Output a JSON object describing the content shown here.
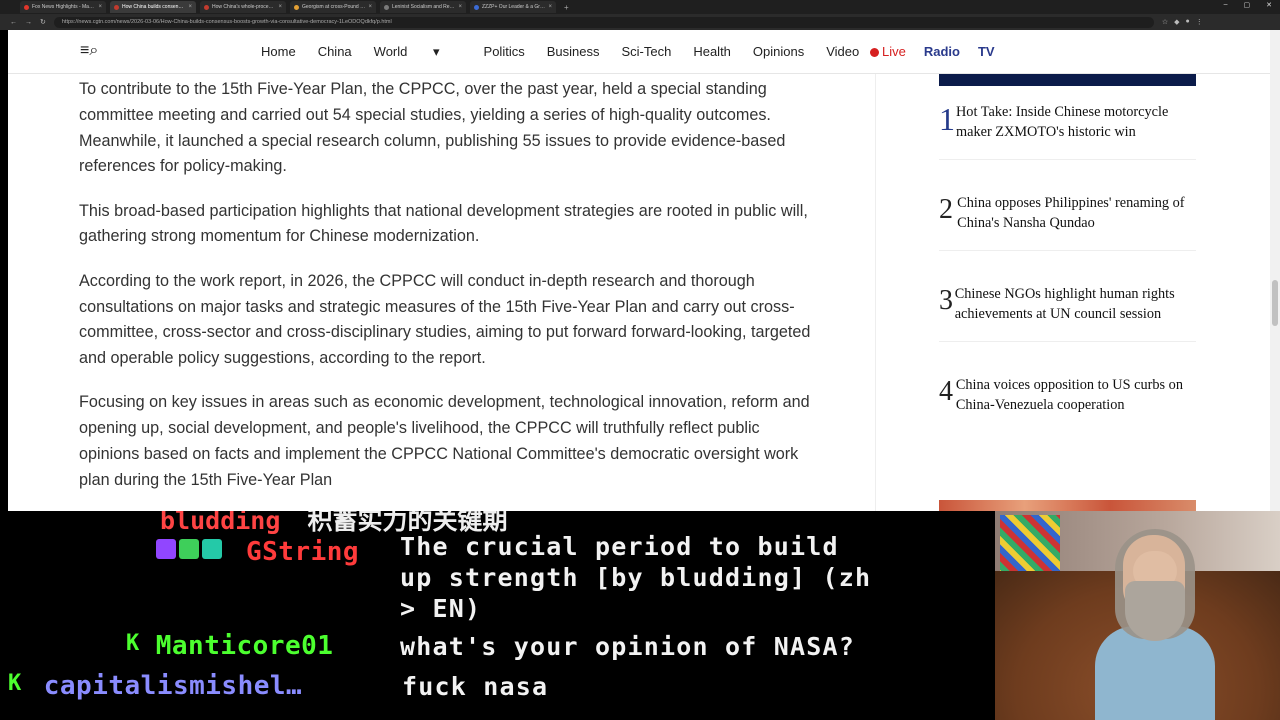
{
  "browser": {
    "tabs": [
      {
        "title": "Fox News Highlights - March 20...",
        "color": "#e0362b",
        "active": false
      },
      {
        "title": "How China builds consensus, bo...",
        "color": "#c23b2e",
        "active": true
      },
      {
        "title": "How China's whole-process peop...",
        "color": "#c23b2e",
        "active": false
      },
      {
        "title": "Georgism at cross-Pound blueprint in...",
        "color": "#e3a034",
        "active": false
      },
      {
        "title": "Leninist Socialism and Religion",
        "color": "#7a7a7a",
        "active": false
      },
      {
        "title": "ZZZP+ Our Leader & a Great Stat...",
        "color": "#3b6bd6",
        "active": false
      }
    ],
    "url": "https://news.cgtn.com/news/2026-03-06/How-China-builds-consensus-boosts-growth-via-consultative-democracy-1LeODOQdkfq/p.html"
  },
  "site": {
    "nav": [
      "Home",
      "China",
      "World",
      "Politics",
      "Business",
      "Sci-Tech",
      "Health",
      "Opinions",
      "Video"
    ],
    "world_chevron": "▾",
    "live": "Live",
    "radio": "Radio",
    "tv": "TV"
  },
  "article": {
    "paragraphs": [
      "To contribute to the 15th Five-Year Plan, the CPPCC, over the past year, held a special standing committee meeting and carried out 54 special studies, yielding a series of high-quality outcomes. Meanwhile, it launched a special research column, publishing 55 issues to provide evidence-based references for policy-making.",
      "This broad-based participation highlights that national development strategies are rooted in public will, gathering strong momentum for Chinese modernization.",
      "According to the work report, in 2026, the CPPCC will conduct in-depth research and thorough consultations on major tasks and strategic measures of the 15th Five-Year Plan and carry out cross-committee, cross-sector and cross-disciplinary studies, aiming to put forward forward-looking, targeted and operable policy suggestions, according to the report.",
      "Focusing on key issues in areas such as economic development, technological innovation, reform and opening up, social development, and people's livelihood, the CPPCC will truthfully reflect public opinions based on facts and implement the CPPCC National Committee's democratic oversight work plan during the 15th Five-Year Plan"
    ]
  },
  "trending": [
    {
      "rank": "1",
      "title": "Hot Take: Inside Chinese motorcycle maker ZXMOTO's historic win"
    },
    {
      "rank": "2",
      "title": "China opposes Philippines' renaming of China's Nansha Qundao"
    },
    {
      "rank": "3",
      "title": "Chinese NGOs highlight human rights achievements at UN council session"
    },
    {
      "rank": "4",
      "title": "China voices opposition to US curbs on China-Venezuela cooperation"
    }
  ],
  "chat": {
    "cut_name": "bludding",
    "cut_text": "积蓄实力的关键期",
    "messages": [
      {
        "user": "GString",
        "user_color": "#ff3b3b",
        "lines": [
          "The crucial period to build",
          "up strength [by bludding] (zh",
          "> EN)"
        ]
      },
      {
        "user": "Manticore01",
        "user_color": "#4cff2f",
        "badge": "K",
        "lines": [
          "what's your opinion of NASA?"
        ]
      },
      {
        "user": "capitalismishel…",
        "user_color": "#8a8cff",
        "badge": "K",
        "lines": [
          "fuck nasa"
        ]
      }
    ]
  }
}
